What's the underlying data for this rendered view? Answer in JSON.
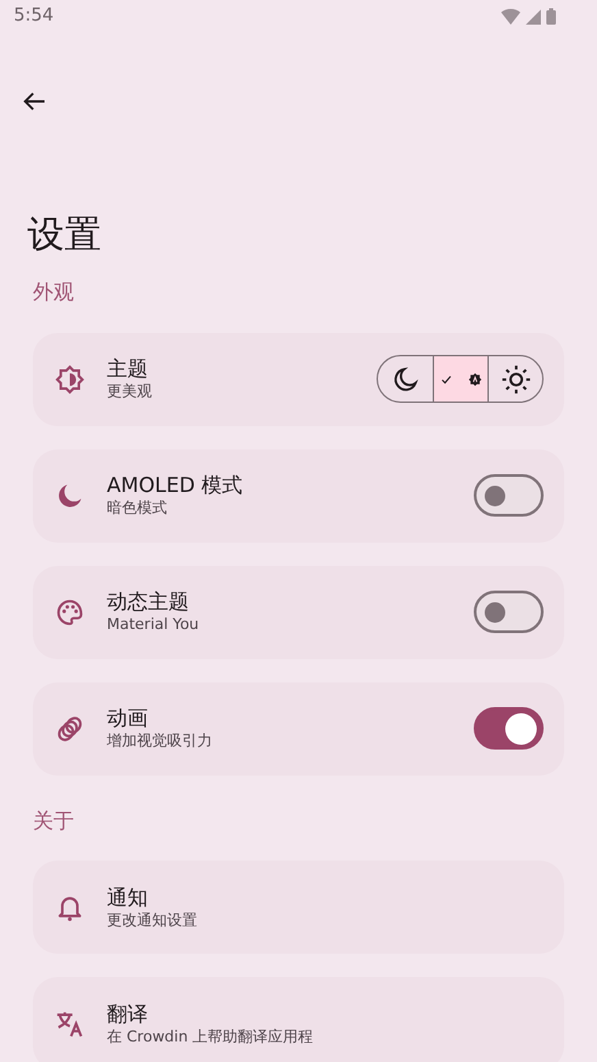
{
  "status_bar": {
    "time": "5:54"
  },
  "header": {
    "title": "设置"
  },
  "sections": [
    {
      "title": "外观",
      "items": [
        {
          "kind": "theme",
          "title": "主题",
          "subtitle": "更美观",
          "options": [
            {
              "selected": false
            },
            {
              "selected": true
            },
            {
              "selected": false
            }
          ]
        },
        {
          "kind": "switch",
          "title": "AMOLED 模式",
          "subtitle": "暗色模式",
          "on": false
        },
        {
          "kind": "switch",
          "title": "动态主题",
          "subtitle": "Material You",
          "on": false
        },
        {
          "kind": "switch",
          "title": "动画",
          "subtitle": "增加视觉吸引力",
          "on": true
        }
      ]
    },
    {
      "title": "关于",
      "items": [
        {
          "kind": "link",
          "title": "通知",
          "subtitle": "更改通知设置"
        },
        {
          "kind": "link",
          "title": "翻译",
          "subtitle": "在 Crowdin 上帮助翻译应用程"
        }
      ]
    }
  ]
}
